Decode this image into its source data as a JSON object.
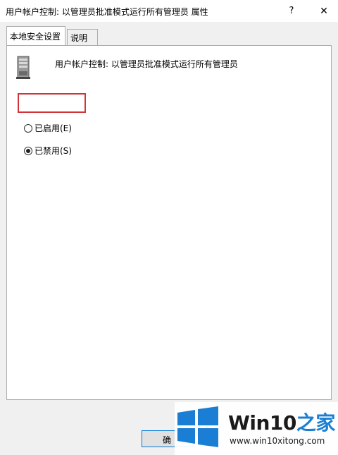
{
  "window": {
    "title": "用户帐户控制: 以管理员批准模式运行所有管理员 属性",
    "help_glyph": "?",
    "close_glyph": "✕"
  },
  "tabs": [
    {
      "label": "本地安全设置",
      "active": true
    },
    {
      "label": "说明",
      "active": false
    }
  ],
  "policy": {
    "name": "用户帐户控制: 以管理员批准模式运行所有管理员",
    "icon": "server-policy-icon"
  },
  "options": {
    "enabled": {
      "label": "已启用(E)",
      "checked": false
    },
    "disabled": {
      "label": "已禁用(S)",
      "checked": true
    }
  },
  "footer": {
    "ok_label": "确"
  },
  "watermark": {
    "brand_prefix": "Win10",
    "brand_suffix": "之家",
    "url": "www.win10xitong.com"
  },
  "colors": {
    "highlight": "#d13438",
    "accent": "#0078d7",
    "brand_blue": "#1a7fd4"
  }
}
